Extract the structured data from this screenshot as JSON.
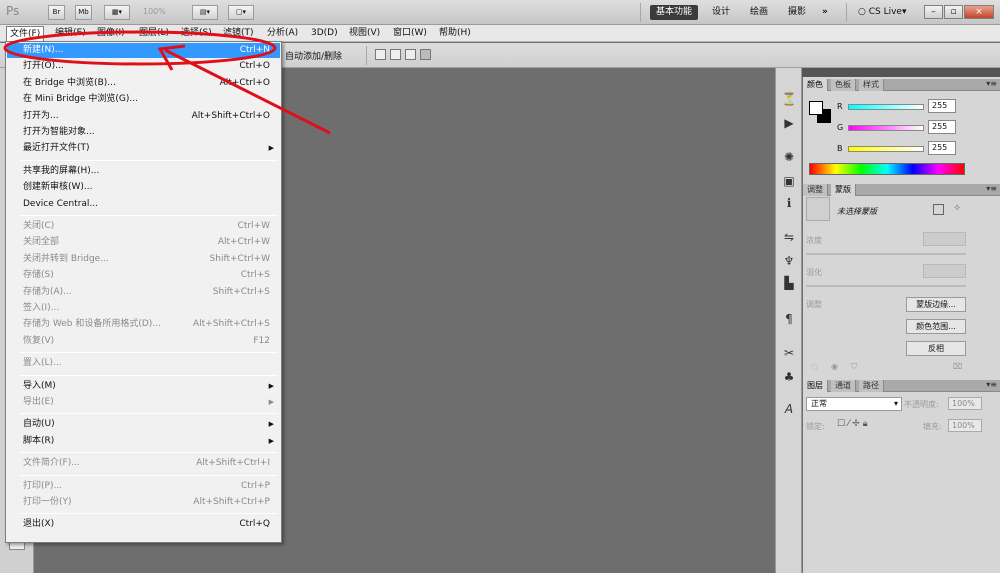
{
  "appbar": {
    "logo": "Ps",
    "btn_br": "Br",
    "btn_mb": "Mb",
    "zoom": "100%",
    "workspaces": [
      "基本功能",
      "设计",
      "绘画",
      "摄影"
    ],
    "more": "»",
    "cslive": "CS Live",
    "win_min": "–",
    "win_max": "▫",
    "win_close": "×"
  },
  "menubar": [
    "文件(F)",
    "编辑(E)",
    "图像(I)",
    "图层(L)",
    "选择(S)",
    "滤镜(T)",
    "分析(A)",
    "3D(D)",
    "视图(V)",
    "窗口(W)",
    "帮助(H)"
  ],
  "options": {
    "auto_add_delete": "自动添加/删除"
  },
  "file_menu": [
    {
      "label": "新建(N)...",
      "shortcut": "Ctrl+N",
      "highlighted": true
    },
    {
      "label": "打开(O)...",
      "shortcut": "Ctrl+O"
    },
    {
      "label": "在 Bridge 中浏览(B)...",
      "shortcut": "Alt+Ctrl+O"
    },
    {
      "label": "在 Mini Bridge 中浏览(G)...",
      "shortcut": ""
    },
    {
      "label": "打开为...",
      "shortcut": "Alt+Shift+Ctrl+O"
    },
    {
      "label": "打开为智能对象...",
      "shortcut": ""
    },
    {
      "label": "最近打开文件(T)",
      "shortcut": "",
      "submenu": true
    },
    {
      "separator": true
    },
    {
      "label": "共享我的屏幕(H)...",
      "shortcut": ""
    },
    {
      "label": "创建新审核(W)...",
      "shortcut": ""
    },
    {
      "label": "Device Central...",
      "shortcut": ""
    },
    {
      "separator": true
    },
    {
      "label": "关闭(C)",
      "shortcut": "Ctrl+W",
      "disabled": true
    },
    {
      "label": "关闭全部",
      "shortcut": "Alt+Ctrl+W",
      "disabled": true
    },
    {
      "label": "关闭并转到 Bridge...",
      "shortcut": "Shift+Ctrl+W",
      "disabled": true
    },
    {
      "label": "存储(S)",
      "shortcut": "Ctrl+S",
      "disabled": true
    },
    {
      "label": "存储为(A)...",
      "shortcut": "Shift+Ctrl+S",
      "disabled": true
    },
    {
      "label": "签入(I)...",
      "shortcut": "",
      "disabled": true
    },
    {
      "label": "存储为 Web 和设备所用格式(D)...",
      "shortcut": "Alt+Shift+Ctrl+S",
      "disabled": true
    },
    {
      "label": "恢复(V)",
      "shortcut": "F12",
      "disabled": true
    },
    {
      "separator": true
    },
    {
      "label": "置入(L)...",
      "shortcut": "",
      "disabled": true
    },
    {
      "separator": true
    },
    {
      "label": "导入(M)",
      "shortcut": "",
      "submenu": true
    },
    {
      "label": "导出(E)",
      "shortcut": "",
      "submenu": true,
      "disabled": true
    },
    {
      "separator": true
    },
    {
      "label": "自动(U)",
      "shortcut": "",
      "submenu": true
    },
    {
      "label": "脚本(R)",
      "shortcut": "",
      "submenu": true
    },
    {
      "separator": true
    },
    {
      "label": "文件简介(F)...",
      "shortcut": "Alt+Shift+Ctrl+I",
      "disabled": true
    },
    {
      "separator": true
    },
    {
      "label": "打印(P)...",
      "shortcut": "Ctrl+P",
      "disabled": true
    },
    {
      "label": "打印一份(Y)",
      "shortcut": "Alt+Shift+Ctrl+P",
      "disabled": true
    },
    {
      "separator": true
    },
    {
      "label": "退出(X)",
      "shortcut": "Ctrl+Q"
    }
  ],
  "color_panel": {
    "tabs": [
      "颜色",
      "色板",
      "样式"
    ],
    "r_label": "R",
    "g_label": "G",
    "b_label": "B",
    "r_value": "255",
    "g_value": "255",
    "b_value": "255"
  },
  "masks_panel": {
    "tabs": [
      "调整",
      "蒙版"
    ],
    "title": "未选择蒙版",
    "density": "浓度",
    "feather": "羽化",
    "refine": "调整",
    "btn_edge": "蒙版边缘...",
    "btn_range": "颜色范围...",
    "btn_invert": "反相"
  },
  "layers_panel": {
    "tabs": [
      "图层",
      "通道",
      "路径"
    ],
    "blend_mode": "正常",
    "opacity_label": "不透明度:",
    "opacity_value": "100%",
    "lock_label": "锁定:",
    "fill_label": "填充:",
    "fill_value": "100%"
  },
  "colors": {
    "highlight": "#3399ff",
    "annotation": "#e0101a"
  }
}
